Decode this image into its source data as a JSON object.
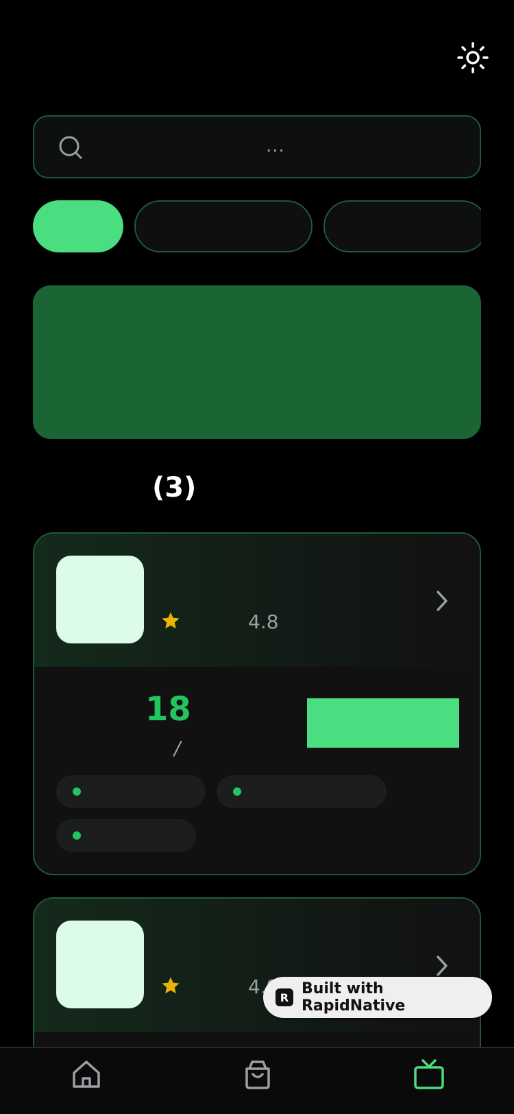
{
  "header": {
    "theme_icon": "sun-icon"
  },
  "search": {
    "placeholder": "...",
    "icon": "search-icon"
  },
  "filters": {
    "chips": [
      "",
      "",
      ""
    ],
    "active_index": 0
  },
  "section": {
    "count_label": "(3)"
  },
  "cards": [
    {
      "rating": "4.8",
      "price": "18",
      "price_separator": "/",
      "tags": [
        "",
        "",
        ""
      ]
    },
    {
      "rating": "4.9"
    }
  ],
  "badge": {
    "logo_letter": "R",
    "label": "Built with RapidNative"
  },
  "tabbar": {
    "items": [
      "home-icon",
      "shopping-bag-icon",
      "tv-icon"
    ],
    "active_index": 2
  },
  "colors": {
    "accent": "#4ade80",
    "accent_dark": "#1b6535",
    "border": "#1e5a34",
    "price": "#22c55e",
    "star": "#eab308",
    "thumb": "#dcfce7"
  }
}
